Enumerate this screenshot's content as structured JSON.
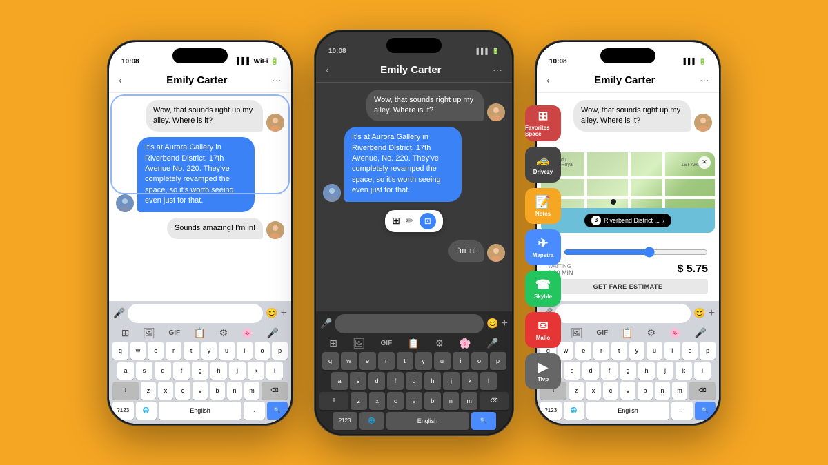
{
  "background": "#F5A623",
  "phones": {
    "phone1": {
      "statusTime": "10:08",
      "title": "Emily Carter",
      "messages": [
        {
          "id": "m1",
          "type": "sent",
          "text": "Wow, that sounds right up my alley. Where is it?"
        },
        {
          "id": "m2",
          "type": "received",
          "text": "It's at Aurora Gallery in Riverbend District, 17th Avenue No. 220. They've completely revamped the space, so it's worth seeing even just for that."
        },
        {
          "id": "m3",
          "type": "sent",
          "text": "Sounds amazing! I'm in!"
        }
      ],
      "inputPlaceholder": "",
      "keyboard": {
        "rows": [
          [
            "q",
            "w",
            "e",
            "r",
            "t",
            "y",
            "u",
            "i",
            "o",
            "p"
          ],
          [
            "a",
            "s",
            "d",
            "f",
            "g",
            "h",
            "j",
            "k",
            "l"
          ],
          [
            "⇧",
            "z",
            "x",
            "c",
            "v",
            "b",
            "n",
            "m",
            "⌫"
          ],
          [
            "?123",
            "🌐",
            "English",
            ".",
            "🔍"
          ]
        ]
      }
    },
    "phone2": {
      "statusTime": "10:08",
      "title": "Emily Carter",
      "messages": [
        {
          "id": "m1",
          "type": "sent",
          "text": "Wow, that sounds right up my alley. Where is it?"
        },
        {
          "id": "m2",
          "type": "received",
          "text": "It's at Aurora Gallery in Riverbend District, 17th Avenue, No. 220. They've completely revamped the space, so it's worth seeing even just for that."
        },
        {
          "id": "m3",
          "type": "sent",
          "text": "I'm in!"
        }
      ],
      "dockItems": [
        {
          "name": "Favorites Space",
          "color": "#e55",
          "symbol": "⊞"
        },
        {
          "name": "Drivezy",
          "color": "#333",
          "symbol": "🚕"
        },
        {
          "name": "Notes",
          "color": "#f5a623",
          "symbol": "📝"
        },
        {
          "name": "Mapstra",
          "color": "#4a90d9",
          "symbol": "✈"
        },
        {
          "name": "Skyble",
          "color": "#22c55e",
          "symbol": "☎"
        },
        {
          "name": "Malio",
          "color": "#e55",
          "symbol": "✉"
        },
        {
          "name": "Tivp",
          "color": "#666",
          "symbol": "▶"
        }
      ],
      "textActions": [
        "⊞",
        "✏",
        "⊡"
      ]
    },
    "phone3": {
      "statusTime": "10:08",
      "title": "Emily Carter",
      "messages": [
        {
          "id": "m1",
          "type": "sent",
          "text": "Wow, that sounds right up my alley. Where is it?"
        }
      ],
      "mapBadge": "Riverbend District ...",
      "fareInfo": {
        "waiting": "WAITING",
        "waitTime": "3:00 MIN",
        "price": "$ 5.75",
        "buttonLabel": "GET FARE ESTIMATE"
      }
    }
  }
}
